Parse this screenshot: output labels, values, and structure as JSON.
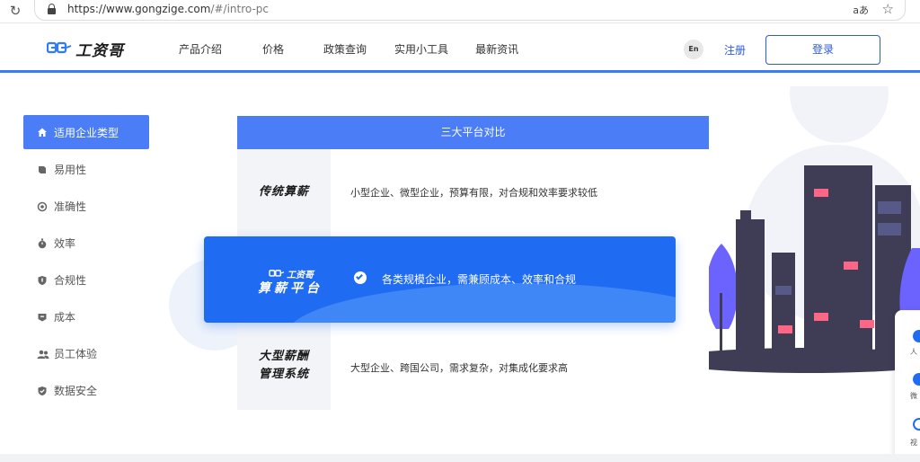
{
  "browser": {
    "url_host": "https://www.gongzige.com",
    "url_path": "/#/intro-pc",
    "reader_label": "aあ"
  },
  "header": {
    "logo_text": "工资哥",
    "nav": [
      "产品介绍",
      "价格",
      "政策查询",
      "实用小工具",
      "最新资讯"
    ],
    "lang": "En",
    "register": "注册",
    "login": "登录"
  },
  "sidebar": {
    "items": [
      {
        "label": "适用企业类型",
        "icon": "home-icon",
        "active": true
      },
      {
        "label": "易用性",
        "icon": "cube-icon"
      },
      {
        "label": "准确性",
        "icon": "target-icon"
      },
      {
        "label": "效率",
        "icon": "stopwatch-icon"
      },
      {
        "label": "合规性",
        "icon": "shield-icon"
      },
      {
        "label": "成本",
        "icon": "wallet-icon"
      },
      {
        "label": "员工体验",
        "icon": "users-icon"
      },
      {
        "label": "数据安全",
        "icon": "shield-check-icon"
      }
    ]
  },
  "comparison": {
    "title": "三大平台对比",
    "rows": [
      {
        "label": "传统算薪",
        "desc": "小型企业、微型企业，预算有限，对合规和效率要求较低"
      },
      {
        "label": "工资哥算薪平台",
        "logo": "工资哥",
        "title": "算薪平台",
        "desc": "各类规模企业，需兼顾成本、效率和合规"
      },
      {
        "label_line1": "大型薪酬",
        "label_line2": "管理系统",
        "desc": "大型企业、跨国公司，需求复杂，对集成化要求高"
      }
    ]
  },
  "floating_panel": {
    "items": [
      "人",
      "微",
      "视"
    ]
  },
  "colors": {
    "primary": "#4a7df6",
    "highlight": "#1f6bf2",
    "brand_blue": "#2e5bd8"
  }
}
